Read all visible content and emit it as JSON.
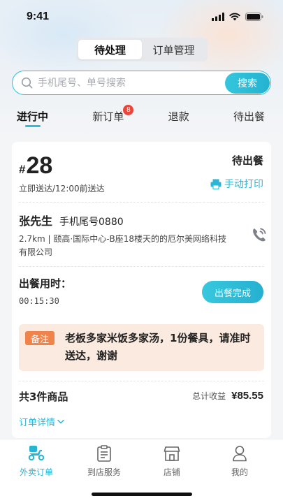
{
  "status_bar": {
    "time": "9:41"
  },
  "segment": {
    "items": [
      "待处理",
      "订单管理"
    ],
    "active": 0
  },
  "search": {
    "placeholder": "手机尾号、单号搜索",
    "button": "搜索"
  },
  "tabs": [
    {
      "label": "进行中",
      "active": true
    },
    {
      "label": "新订单",
      "badge": "8"
    },
    {
      "label": "退款"
    },
    {
      "label": "待出餐"
    }
  ],
  "order": {
    "hash": "#",
    "number": "28",
    "deliver": "立即送达/12:00前送达",
    "status": "待出餐",
    "print": "手动打印",
    "customer_name": "张先生",
    "customer_phone": "手机尾号0880",
    "address": "2.7km | 颐高·国际中心-B座18楼天的的厄尔美网络科技有限公司",
    "meal_label": "出餐用时：",
    "meal_time": "00:15:30",
    "meal_button": "出餐完成",
    "note_tag": "备注",
    "note_text": "老板多家米饭多家汤，1份餐具，请准时送达，谢谢",
    "goods_count": "共3件商品",
    "income_label": "总计收益",
    "income_amount": "¥85.55",
    "detail_link": "订单详情"
  },
  "tabbar": [
    {
      "label": "外卖订单",
      "icon": "scooter-icon",
      "active": true
    },
    {
      "label": "到店服务",
      "icon": "clipboard-icon"
    },
    {
      "label": "店铺",
      "icon": "store-icon"
    },
    {
      "label": "我的",
      "icon": "user-icon"
    }
  ],
  "colors": {
    "accent": "#2fbcd6",
    "badge": "#e8463c",
    "note_bg": "#fbeadf",
    "note_tag": "#f0834a"
  }
}
